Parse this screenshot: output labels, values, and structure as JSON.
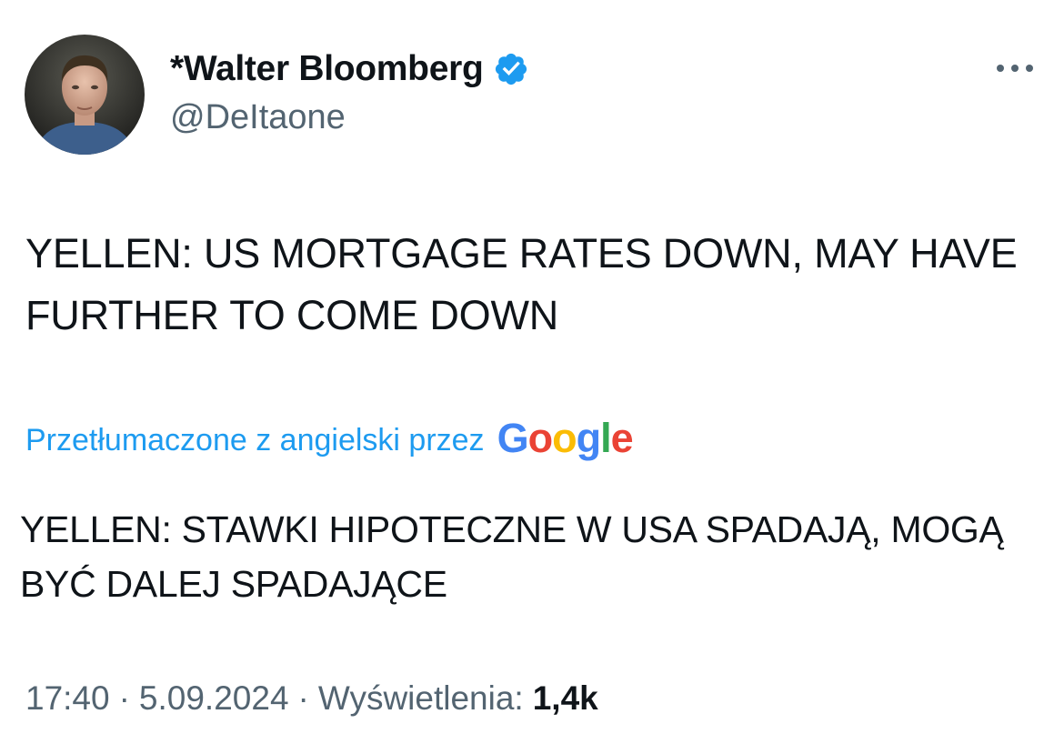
{
  "author": {
    "display_name": "*Walter Bloomberg",
    "handle": "@DeItaone",
    "verified_color": "#1d9bf0"
  },
  "tweet": {
    "text": "YELLEN: US MORTGAGE RATES DOWN, MAY HAVE FURTHER TO COME DOWN"
  },
  "translation": {
    "label": "Przetłumaczone z angielski przez",
    "provider_letters": [
      "G",
      "o",
      "o",
      "g",
      "l",
      "e"
    ],
    "provider_colors": [
      "#4285f4",
      "#ea4335",
      "#fbbc05",
      "#4285f4",
      "#34a853",
      "#ea4335"
    ],
    "text": "YELLEN: STAWKI HIPOTECZNE W USA SPADAJĄ, MOGĄ BYĆ DALEJ SPADAJĄCE"
  },
  "meta": {
    "time": "17:40",
    "separator": "·",
    "date": "5.09.2024",
    "views_label": "Wyświetlenia:",
    "views_count": "1,4k"
  },
  "icons": {
    "avatar": "avatar",
    "verified": "verified-badge-icon",
    "more": "more-options-icon"
  },
  "colors": {
    "text_primary": "#0f1419",
    "text_secondary": "#536471",
    "accent": "#1d9bf0"
  }
}
